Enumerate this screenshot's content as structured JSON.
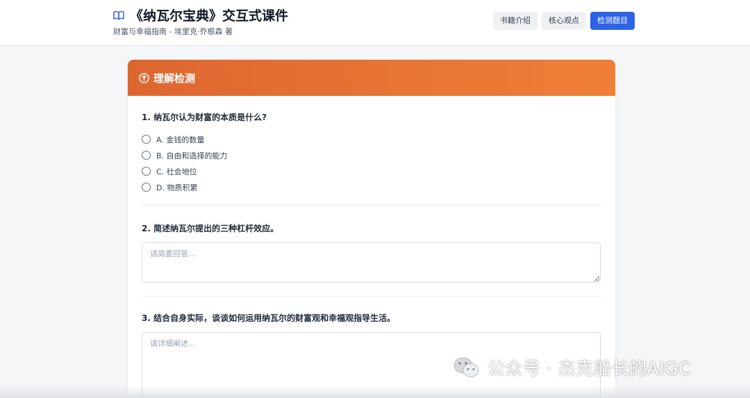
{
  "header": {
    "title": "《纳瓦尔宝典》交互式课件",
    "subtitle": "财富与幸福指南 - 埃里克·乔根森 著",
    "icon": "book-open-icon",
    "nav": [
      {
        "label": "书籍介绍",
        "active": false
      },
      {
        "label": "核心观点",
        "active": false
      },
      {
        "label": "检测题目",
        "active": true
      }
    ],
    "accent_color": "#2f63e6"
  },
  "quiz": {
    "title": "理解检测",
    "icon": "info-circle-icon",
    "header_colors": [
      "#dd6630",
      "#ee7f37"
    ],
    "questions": [
      {
        "title": "1. 纳瓦尔认为财富的本质是什么?",
        "options": [
          "A. 金钱的数量",
          "B. 自由和选择的能力",
          "C. 社会地位",
          "D. 物质积累"
        ]
      },
      {
        "title": "2. 简述纳瓦尔提出的三种杠杆效应。",
        "placeholder": "请简要回答..."
      },
      {
        "title": "3. 结合自身实际，谈谈如何运用纳瓦尔的财富观和幸福观指导生活。",
        "placeholder": "请详细阐述..."
      }
    ]
  },
  "watermark": {
    "icon": "wechat-icon",
    "text": "公众号 · 杰克船长的AIGC"
  }
}
